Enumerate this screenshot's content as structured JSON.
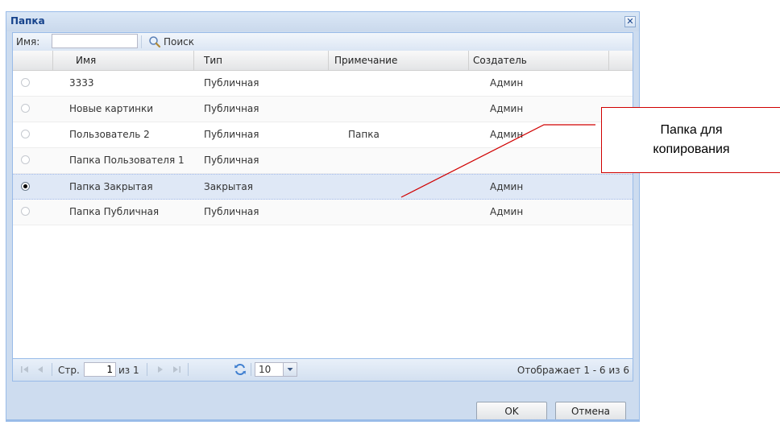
{
  "dialog": {
    "title": "Папка",
    "close_symbol": "✕"
  },
  "search": {
    "label": "Имя:",
    "value": "",
    "button_label": "Поиск"
  },
  "grid": {
    "columns": [
      "Имя",
      "Тип",
      "Примечание",
      "Создатель"
    ],
    "rows": [
      {
        "selected": false,
        "name": "3333",
        "type": "Публичная",
        "note": "",
        "creator": "Админ"
      },
      {
        "selected": false,
        "name": "Новые картинки",
        "type": "Публичная",
        "note": "",
        "creator": "Админ"
      },
      {
        "selected": false,
        "name": "Пользователь 2",
        "type": "Публичная",
        "note": "Папка",
        "creator": "Админ"
      },
      {
        "selected": false,
        "name": "Папка Пользователя 1",
        "type": "Публичная",
        "note": "",
        "creator": ""
      },
      {
        "selected": true,
        "name": "Папка Закрытая",
        "type": "Закрытая",
        "note": "",
        "creator": "Админ"
      },
      {
        "selected": false,
        "name": "Папка Публичная",
        "type": "Публичная",
        "note": "",
        "creator": "Админ"
      }
    ]
  },
  "paging": {
    "page_label": "Стр.",
    "page_value": "1",
    "of_label": "из 1",
    "page_size": "10",
    "display_text": "Отображает 1 - 6 из 6"
  },
  "buttons": {
    "ok": "OK",
    "cancel": "Отмена"
  },
  "callout": {
    "line1": "Папка для",
    "line2": "копирования",
    "color": "#d00000"
  }
}
